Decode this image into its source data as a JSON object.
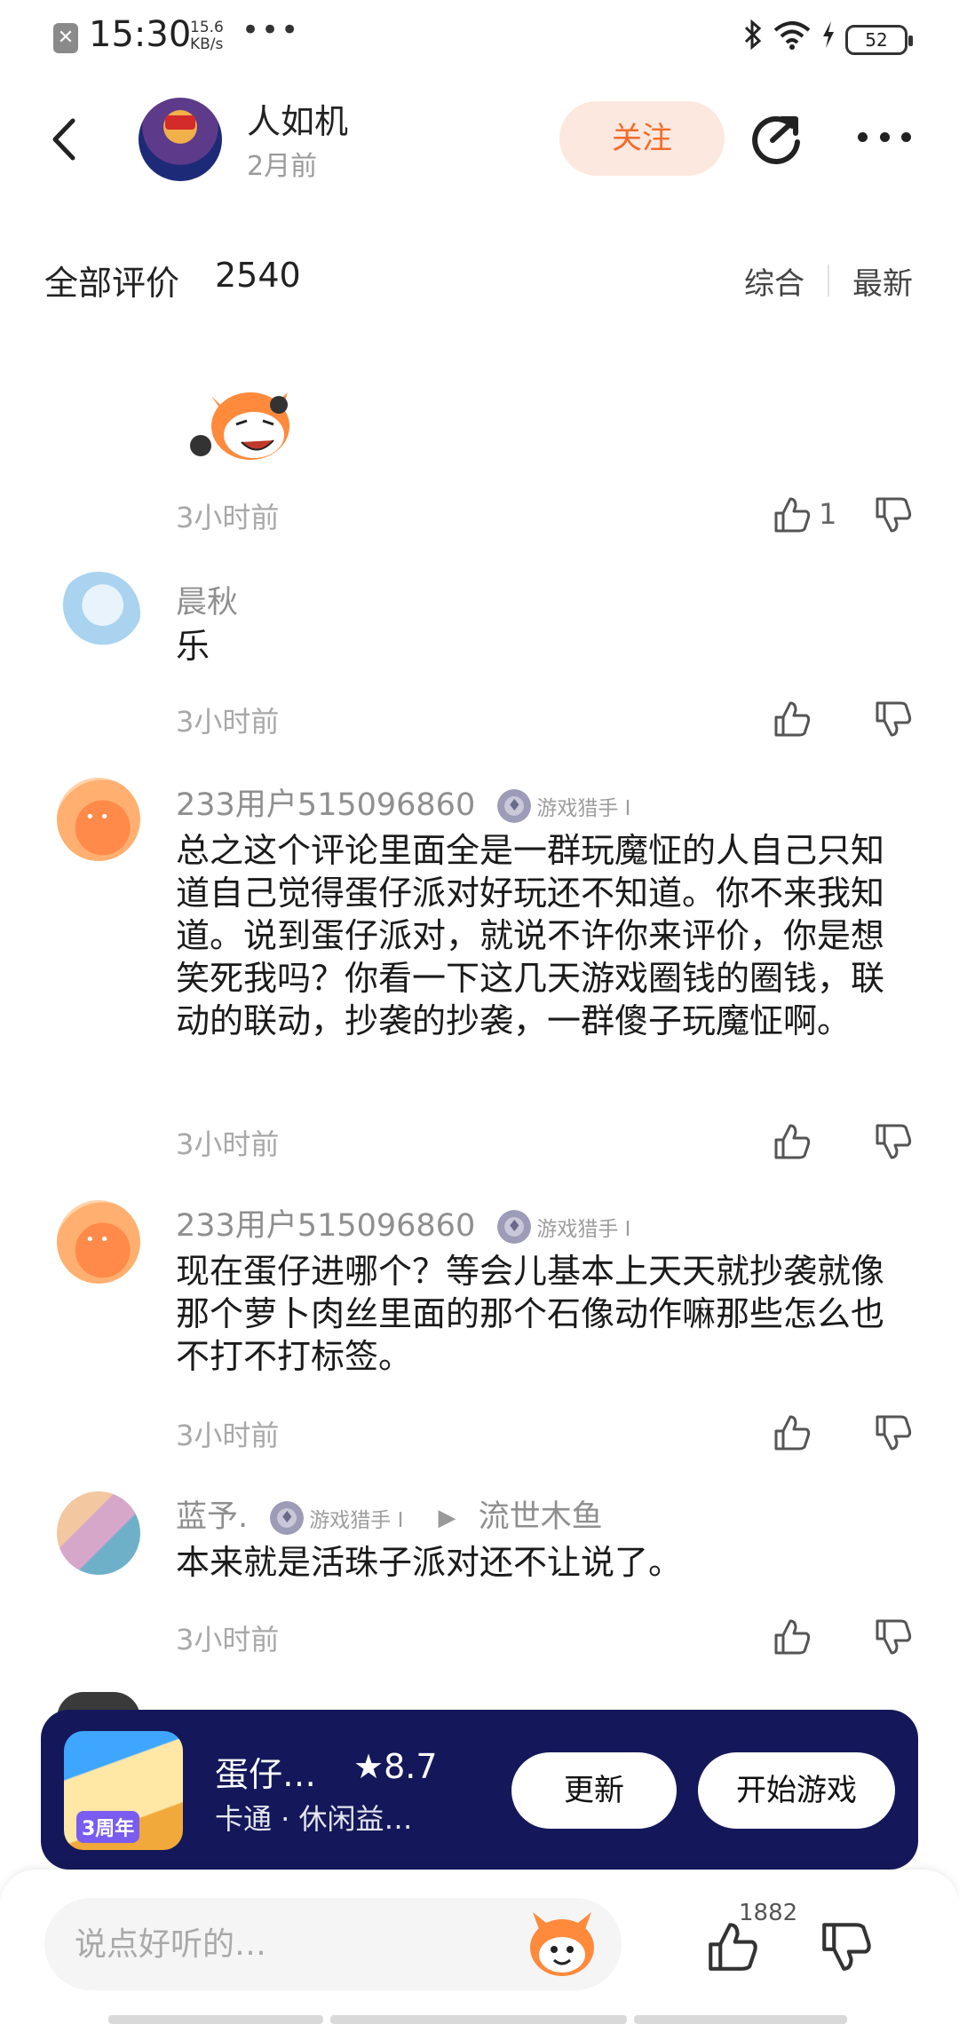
{
  "status_bar": {
    "time": "15:30",
    "net_speed_value": "15.6",
    "net_speed_unit": "KB/s",
    "more": "•••",
    "battery": "52",
    "icons": [
      "notification-close-icon",
      "bluetooth-icon",
      "wifi-icon",
      "charging-icon",
      "battery-icon"
    ]
  },
  "header": {
    "author_name": "人如机",
    "author_time": "2月前",
    "follow_label": "关注",
    "accent_color": "#f26b2a"
  },
  "section": {
    "title": "全部评价",
    "count": "2540",
    "sort_options": [
      "综合",
      "最新"
    ]
  },
  "replies": [
    {
      "user": "",
      "text": "",
      "time": "3小时前",
      "likes": "1",
      "sticker": "mascot-sticker"
    },
    {
      "user": "晨秋",
      "text": "乐",
      "time": "3小时前",
      "likes": ""
    },
    {
      "user": "233用户515096860",
      "badge": "游戏猎手 I",
      "text": "总之这个评论里面全是一群玩魔怔的人自己只知道自己觉得蛋仔派对好玩还不知道。你不来我知道。说到蛋仔派对，就说不许你来评价，你是想笑死我吗？你看一下这几天游戏圈钱的圈钱，联动的联动，抄袭的抄袭，一群傻子玩魔怔啊。",
      "time": "3小时前",
      "likes": ""
    },
    {
      "user": "233用户515096860",
      "badge": "游戏猎手 I",
      "text": "现在蛋仔进哪个？等会儿基本上天天就抄袭就像那个萝卜肉丝里面的那个石像动作嘛那些怎么也不打不打标签。",
      "time": "3小时前",
      "likes": ""
    },
    {
      "user": "蓝予.",
      "badge": "游戏猎手 I",
      "reply_to_arrow": "▶",
      "reply_to": "流世木鱼",
      "text": "本来就是活珠子派对还不让说了。",
      "time": "3小时前",
      "likes": ""
    }
  ],
  "game_card": {
    "name": "蛋仔…",
    "rating": "8.7",
    "tags": "卡通 · 休闲益…",
    "icon_badge": "3周年",
    "update_label": "更新",
    "play_label": "开始游戏",
    "bg_color": "#14185a"
  },
  "bottom_bar": {
    "input_placeholder": "说点好听的…",
    "like_count": "1882"
  }
}
